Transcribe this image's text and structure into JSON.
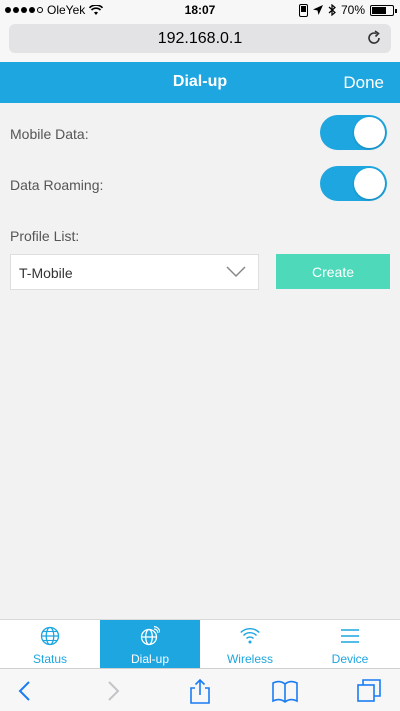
{
  "status_bar": {
    "carrier": "OleYek",
    "time": "18:07",
    "battery": "70%",
    "battery_level": 0.7,
    "signal_bars": 4
  },
  "browser": {
    "url": "192.168.0.1",
    "reload_icon": "reload-icon"
  },
  "header": {
    "title": "Dial-up",
    "done_label": "Done"
  },
  "settings": {
    "mobile_data_label": "Mobile Data:",
    "mobile_data_on": true,
    "data_roaming_label": "Data Roaming:",
    "data_roaming_on": true,
    "profile_list_label": "Profile List:",
    "profile_selected": "T-Mobile",
    "create_label": "Create"
  },
  "tabs": [
    {
      "label": "Status",
      "icon": "globe-icon",
      "active": false
    },
    {
      "label": "Dial-up",
      "icon": "dialup-globe-icon",
      "active": true
    },
    {
      "label": "Wireless",
      "icon": "wifi-icon",
      "active": false
    },
    {
      "label": "Device",
      "icon": "menu-icon",
      "active": false
    }
  ],
  "colors": {
    "accent": "#1da6e0",
    "create_button": "#4ed9ba",
    "background": "#f2f2f2"
  }
}
